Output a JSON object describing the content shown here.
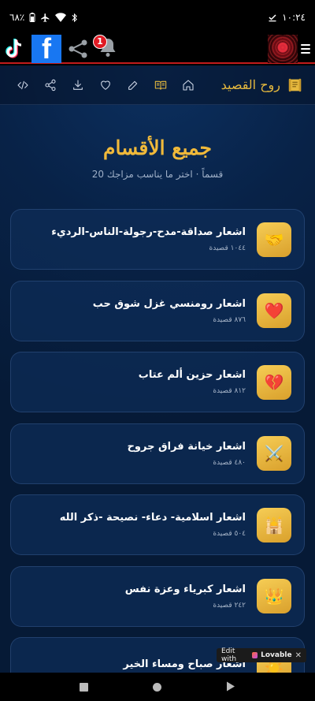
{
  "status_bar": {
    "time": "١٠:٢٤",
    "battery": "٦٨٪"
  },
  "app_bar": {
    "notification_count": "1",
    "facebook_glyph": "f"
  },
  "toolbar": {
    "brand": "روح القصيد",
    "icons": [
      "code-icon",
      "share-icon",
      "download-icon",
      "heart-icon",
      "edit-icon",
      "book-icon",
      "home-icon"
    ]
  },
  "page": {
    "title": "جميع الأقسام",
    "subtitle": "20 قسماً · اختر ما يناسب مزاجك"
  },
  "categories": [
    {
      "title": "اشعار صداقة-مدح-رجولة-الناس-الرديء",
      "count": "١٠٤٤ قصيدة",
      "emoji": "🤝"
    },
    {
      "title": "اشعار رومنسي غزل شوق حب",
      "count": "٨٧٦ قصيدة",
      "emoji": "❤️"
    },
    {
      "title": "اشعار حزين ألم عتاب",
      "count": "٨١٢ قصيدة",
      "emoji": "💔"
    },
    {
      "title": "اشعار خيانة فراق جروح",
      "count": "٤٨٠ قصيدة",
      "emoji": "⚔️"
    },
    {
      "title": "اشعار اسلامية- دعاء- نصيحة -ذكر الله",
      "count": "٥٠٤ قصيدة",
      "emoji": "🕌"
    },
    {
      "title": "اشعار كبرياء وعزة نفس",
      "count": "٢٤٢ قصيدة",
      "emoji": "👑"
    },
    {
      "title": "اشعار صباح ومساء الخير",
      "count": "",
      "emoji": "☀️"
    }
  ],
  "lovable_badge": {
    "prefix": "Edit with",
    "brand": "Lovable",
    "close": "✕"
  },
  "colors": {
    "accent_gold": "#e6b93e",
    "background_navy": "#082247",
    "red_divider": "#c21b1b"
  }
}
